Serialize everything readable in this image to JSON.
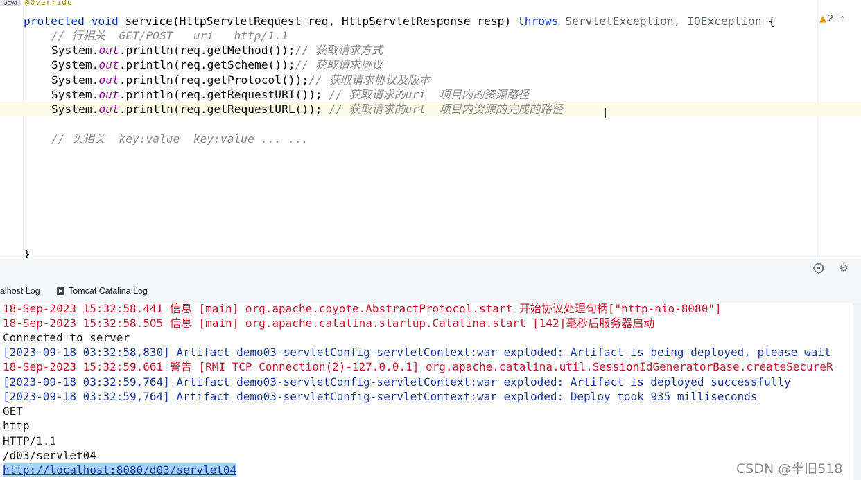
{
  "editor": {
    "file_tab": "Java",
    "annotation_peek": "@Override",
    "warnings_count": "2",
    "code": {
      "line1": {
        "kw1": "protected",
        "kw2": "void",
        "sig": "service(HttpServletRequest req, HttpServletResponse resp)",
        "throws": "throws",
        "exc": "ServletException, IOException",
        "brace": " {"
      },
      "line2_comment": "// 行相关  GET/POST   uri   http/1.1",
      "line3": {
        "pre": "System.",
        "field": "out",
        "post": ".println(req.getMethod());",
        "comment": "// 获取请求方式"
      },
      "line4": {
        "pre": "System.",
        "field": "out",
        "post": ".println(req.getScheme());",
        "comment": "// 获取请求协议"
      },
      "line5": {
        "pre": "System.",
        "field": "out",
        "post": ".println(req.getProtocol());",
        "comment": "// 获取请求协议及版本"
      },
      "line6": {
        "pre": "System.",
        "field": "out",
        "post": ".println(req.getRequestURI()); ",
        "comment": "// 获取请求的uri  项目内的资源路径"
      },
      "line7": {
        "pre": "System.",
        "field": "out",
        "post": ".println(req.getRequestURL()); ",
        "comment": "// 获取请求的url  项目内资源的完成的路径"
      },
      "line9_comment": "// 头相关  key:value  key:value ... ...",
      "closing_brace": "}"
    }
  },
  "console_tabs": [
    {
      "label": "alhost Log"
    },
    {
      "label": "Tomcat Catalina Log"
    }
  ],
  "console": {
    "lines": [
      "18-Sep-2023 15:32:58.441 信息 [main] org.apache.coyote.AbstractProtocol.start 开始协议处理句柄[\"http-nio-8080\"]",
      "18-Sep-2023 15:32:58.505 信息 [main] org.apache.catalina.startup.Catalina.start [142]毫秒后服务器启动",
      "Connected to server",
      "[2023-09-18 03:32:58,830] Artifact demo03-servletConfig-servletContext:war exploded: Artifact is being deployed, please wait",
      "18-Sep-2023 15:32:59.661 警告 [RMI TCP Connection(2)-127.0.0.1] org.apache.catalina.util.SessionIdGeneratorBase.createSecureR",
      "[2023-09-18 03:32:59,764] Artifact demo03-servletConfig-servletContext:war exploded: Artifact is deployed successfully",
      "[2023-09-18 03:32:59,764] Artifact demo03-servletConfig-servletContext:war exploded: Deploy took 935 milliseconds",
      "GET",
      "http",
      "HTTP/1.1",
      "/d03/servlet04",
      "http://localhost:8080/d03/servlet04"
    ]
  },
  "watermark": "CSDN @半旧518",
  "icons": {
    "warning": "warning-icon",
    "chevron": "chevron-up-icon",
    "target": "crosshair-icon",
    "settings": "gear-icon",
    "tab": "console-tab-icon"
  },
  "colors": {
    "keyword": "#0033b3",
    "field": "#871094",
    "comment": "#8c8c8c",
    "log_red": "#c8192f",
    "log_blue": "#1d3a9c",
    "selection": "#a6d2ff"
  }
}
